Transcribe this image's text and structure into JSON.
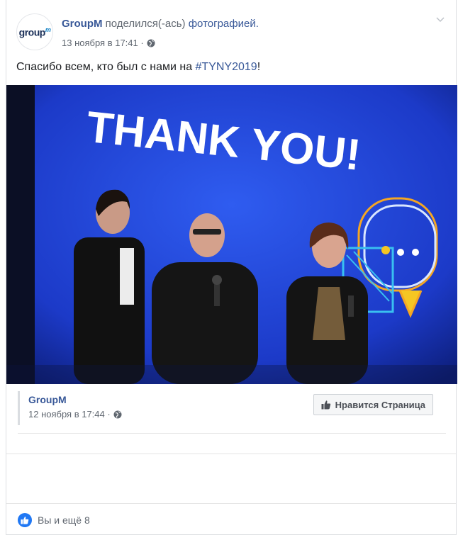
{
  "post": {
    "author": "GroupM",
    "action_text": " поделился(-ась) ",
    "action_link": "фотографией.",
    "timestamp": "13 ноября в 17:41 ·",
    "caption_prefix": "Спасибо всем, кто был с нами на ",
    "caption_hashtag": "#TYNY2019",
    "caption_suffix": "!"
  },
  "avatar": {
    "logo_text": "group",
    "logo_sup": "m"
  },
  "photo": {
    "headline": "THANK YOU!"
  },
  "attachment": {
    "name": "GroupM",
    "timestamp": "12 ноября в 17:44 ·",
    "like_page_label": "Нравится Страница"
  },
  "reactions": {
    "summary": "Вы и ещё 8"
  },
  "icons": {
    "globe": "globe-icon",
    "chevron": "chevron-down-icon",
    "thumb": "thumbs-up-icon"
  },
  "colors": {
    "link": "#385898",
    "like_blue": "#2078f4",
    "stage_blue": "#1e3fcf"
  }
}
